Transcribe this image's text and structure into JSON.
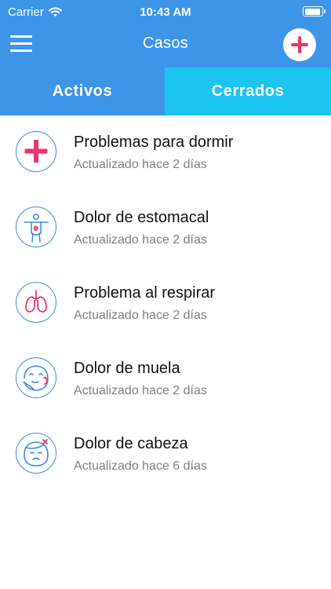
{
  "status_bar": {
    "carrier": "Carrier",
    "time": "10:43 AM"
  },
  "nav": {
    "title": "Casos"
  },
  "tabs": [
    {
      "label": "Activos"
    },
    {
      "label": "Cerrados"
    }
  ],
  "cases": [
    {
      "title": "Problemas para dormir",
      "updated": "Actualizado hace 2 días",
      "icon": "medical-cross-icon"
    },
    {
      "title": "Dolor de estomacal",
      "updated": "Actualizado hace 2 días",
      "icon": "stomach-body-icon"
    },
    {
      "title": "Problema al respirar",
      "updated": "Actualizado hace 2 días",
      "icon": "lungs-icon"
    },
    {
      "title": "Dolor de muela",
      "updated": "Actualizado hace 2 días",
      "icon": "toothache-face-icon"
    },
    {
      "title": "Dolor de cabeza",
      "updated": "Actualizado hace 6 días",
      "icon": "headache-face-icon"
    }
  ],
  "colors": {
    "primary_blue": "#3d95e8",
    "selected_tab_cyan": "#1bc5ef",
    "accent_pink": "#e8366a",
    "subtitle_gray": "#808080"
  }
}
